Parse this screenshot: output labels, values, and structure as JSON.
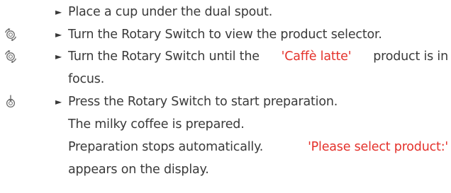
{
  "steps": [
    {
      "bullet": "►",
      "text": "Place a cup under the dual spout."
    },
    {
      "bullet": "►",
      "icon": "rotary-switch-turn-icon",
      "text": "Turn the Rotary Switch to view the product selector."
    },
    {
      "bullet": "►",
      "icon": "rotary-switch-turn-icon",
      "text_a": "Turn the Rotary Switch until the ",
      "highlight": "'Caffè latte'",
      "text_b": " product is in",
      "cont": "focus."
    },
    {
      "bullet": "►",
      "icon": "rotary-switch-press-icon",
      "text": "Press the Rotary Switch to start preparation."
    }
  ],
  "results": {
    "line1": "The milky coffee is prepared.",
    "line2_a": "Preparation stops automatically. ",
    "line2_highlight": "'Please select product:'",
    "line3": "appears on the display."
  },
  "colors": {
    "text": "#3a3a3a",
    "highlight": "#e4312b",
    "icon": "#6b6b6b"
  }
}
